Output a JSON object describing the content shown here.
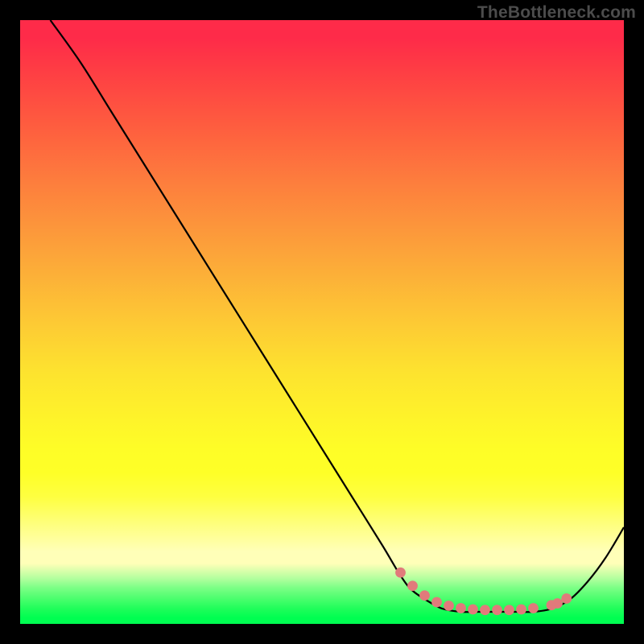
{
  "watermark": "TheBottleneck.com",
  "colors": {
    "black": "#000000",
    "curve": "#000000",
    "markers": "#e17a7b",
    "gradient_top": "#fe2b49",
    "gradient_bottom": "#00fe51"
  },
  "chart_data": {
    "type": "line",
    "title": "",
    "xlabel": "",
    "ylabel": "",
    "xlim": [
      0,
      100
    ],
    "ylim": [
      0,
      100
    ],
    "series": [
      {
        "name": "bottleneck-curve",
        "x": [
          5,
          10,
          15,
          20,
          25,
          30,
          35,
          40,
          45,
          50,
          55,
          60,
          63,
          65,
          68,
          70,
          73,
          76,
          79,
          82,
          85,
          88,
          91,
          94,
          97,
          100
        ],
        "y": [
          100,
          93,
          85,
          77,
          69,
          61,
          53,
          45,
          37,
          29,
          21,
          13,
          8,
          5.5,
          3.5,
          2.5,
          2,
          2,
          2,
          2,
          2,
          2.5,
          4,
          7,
          11,
          16
        ]
      }
    ],
    "markers": {
      "name": "highlight-band",
      "x": [
        63,
        65,
        67,
        69,
        71,
        73,
        75,
        77,
        79,
        81,
        83,
        85,
        88,
        89,
        90.5
      ],
      "y": [
        8.5,
        6.3,
        4.7,
        3.6,
        3.0,
        2.6,
        2.4,
        2.3,
        2.3,
        2.3,
        2.4,
        2.6,
        3.1,
        3.4,
        4.2
      ]
    }
  }
}
